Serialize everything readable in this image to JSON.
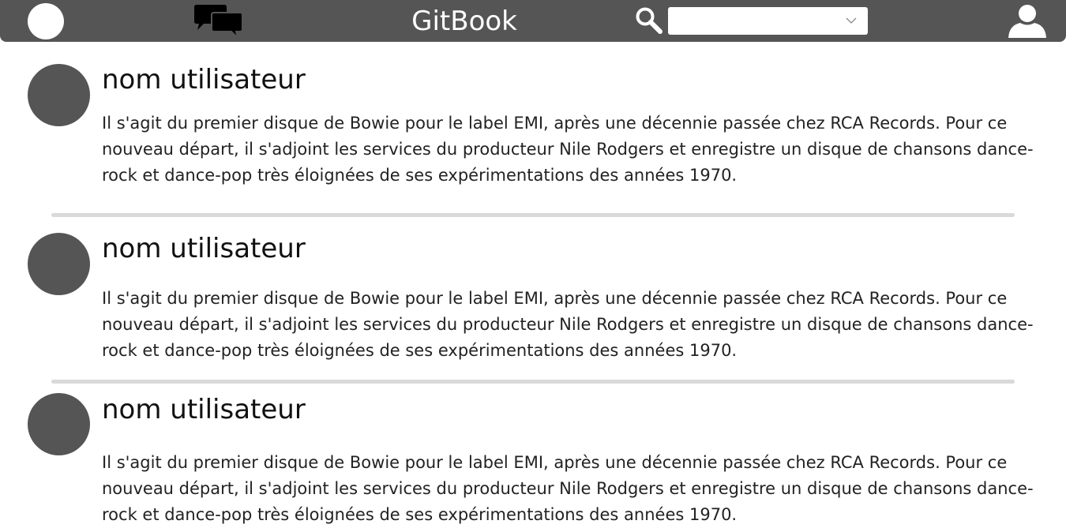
{
  "header": {
    "brand": "GitBook",
    "home_icon": "home-circle-icon",
    "chat_icon": "chat-bubbles-icon",
    "search_icon": "magnifier-icon",
    "search_select_value": "",
    "user_icon": "user-icon",
    "background_color": "#555555"
  },
  "posts": [
    {
      "username": "nom utilisateur",
      "text": "Il s'agit du premier disque de Bowie pour le label EMI, après une décennie passée chez RCA Records. Pour ce nouveau départ, il s'adjoint les services du producteur Nile Rodgers et enregistre un disque de chansons dance-rock et dance-pop très éloignées de ses expérimentations des années 1970."
    },
    {
      "username": "nom utilisateur",
      "text": "Il s'agit du premier disque de Bowie pour le label EMI, après une décennie passée chez RCA Records. Pour ce nouveau départ, il s'adjoint les services du producteur Nile Rodgers et enregistre un disque de chansons dance-rock et dance-pop très éloignées de ses expérimentations des années 1970."
    },
    {
      "username": "nom utilisateur",
      "text": "Il s'agit du premier disque de Bowie pour le label EMI, après une décennie passée chez RCA Records. Pour ce nouveau départ, il s'adjoint les services du producteur Nile Rodgers et enregistre un disque de chansons dance-rock et dance-pop très éloignées de ses expérimentations des années 1970."
    }
  ]
}
